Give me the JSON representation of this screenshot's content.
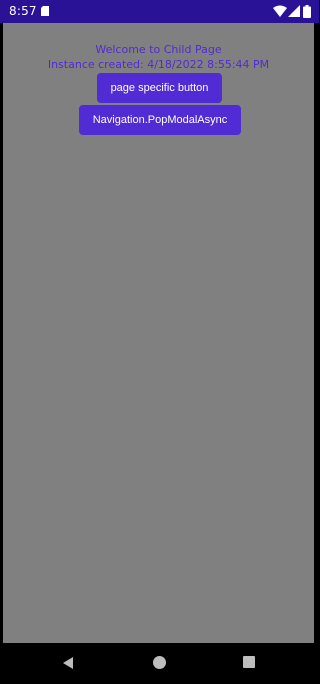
{
  "status_bar": {
    "time": "8:57",
    "background_color": "#2a1296",
    "icons": [
      "sd-card-icon",
      "wifi-icon",
      "cell-signal-icon",
      "battery-icon"
    ]
  },
  "page": {
    "background_color": "#808080",
    "accent_color": "#512bd4",
    "welcome_text": "Welcome to Child Page",
    "instance_text": "Instance created: 4/18/2022 8:55:44 PM",
    "page_button_label": "page specific button",
    "pop_button_label": "Navigation.PopModalAsync"
  },
  "nav_bar": {
    "icons": [
      "back-icon",
      "home-icon",
      "recents-icon"
    ]
  }
}
